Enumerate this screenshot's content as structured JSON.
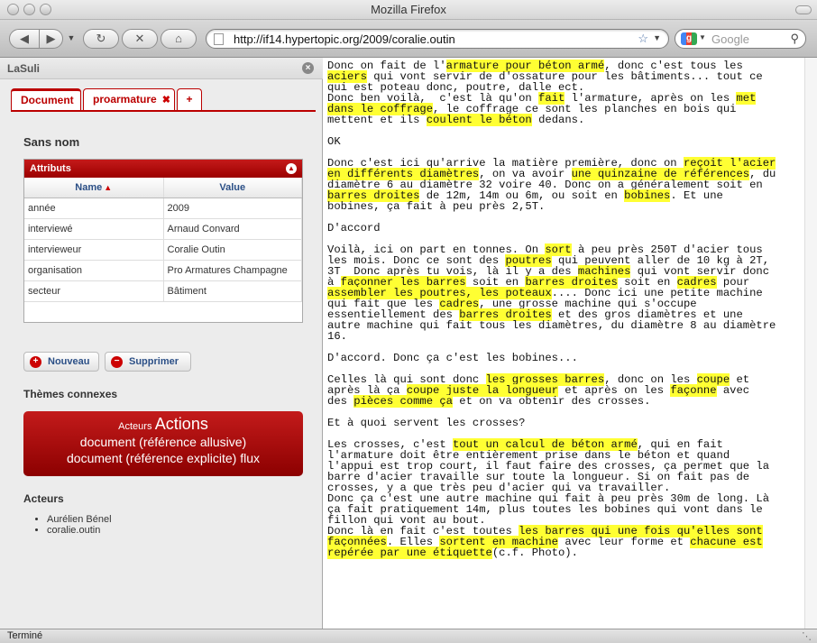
{
  "window": {
    "title": "Mozilla Firefox"
  },
  "toolbar": {
    "url": "http://if14.hypertopic.org/2009/coralie.outin",
    "search_placeholder": "Google",
    "search_engine_label": "g"
  },
  "sidebar": {
    "title": "LaSuli",
    "tabs": [
      {
        "label": "Document"
      },
      {
        "label": "proarmature"
      },
      {
        "label": "+"
      }
    ],
    "document_title": "Sans nom",
    "attributes": {
      "title": "Attributs",
      "col_name": "Name",
      "col_value": "Value",
      "rows": [
        {
          "name": "année",
          "value": "2009"
        },
        {
          "name": "interviewé",
          "value": "Arnaud Convard"
        },
        {
          "name": "intervieweur",
          "value": "Coralie Outin"
        },
        {
          "name": "organisation",
          "value": "Pro Armatures Champagne"
        },
        {
          "name": "secteur",
          "value": "Bâtiment"
        }
      ]
    },
    "buttons": {
      "new": "Nouveau",
      "delete": "Supprimer"
    },
    "themes_title": "Thèmes connexes",
    "tags": {
      "acteurs": "Acteurs",
      "actions": "Actions",
      "allusive": "document (référence allusive)",
      "explicite": "document (référence explicite)",
      "flux": "flux"
    },
    "acteurs_title": "Acteurs",
    "acteurs": [
      "Aurélien Bénel",
      "coralie.outin"
    ]
  },
  "content": {
    "paragraphs": [
      [
        {
          "t": "Donc on fait de l'"
        },
        {
          "h": "armature pour béton armé"
        },
        {
          "t": ", donc c'est tous les\n"
        },
        {
          "h": "aciers"
        },
        {
          "t": " qui vont servir de d'ossature pour les bâtiments... tout ce\nqui est poteau donc, poutre, dalle ect.\nDonc ben voilà,  c'est là qu'on "
        },
        {
          "h": "fait"
        },
        {
          "t": " l'armature, après on les "
        },
        {
          "h": "met\ndans le coffrage"
        },
        {
          "t": ", le coffrage ce sont les planches en bois qui\nmettent et ils "
        },
        {
          "h": "coulent le béton"
        },
        {
          "t": " dedans."
        }
      ],
      [
        {
          "t": "OK"
        }
      ],
      [
        {
          "t": "Donc c'est ici qu'arrive la matière première, donc on "
        },
        {
          "h": "reçoit l'acier\nen différents diamètres"
        },
        {
          "t": ", on va avoir "
        },
        {
          "h": "une quinzaine de références"
        },
        {
          "t": ", du\ndiamètre 6 au diamètre 32 voire 40. Donc on a généralement soit en\n"
        },
        {
          "h": "barres droites"
        },
        {
          "t": " de 12m, 14m ou 6m, ou soit en "
        },
        {
          "h": "bobines"
        },
        {
          "t": ". Et une\nbobines, ça fait à peu près 2,5T."
        }
      ],
      [
        {
          "t": "D'accord"
        }
      ],
      [
        {
          "t": "Voilà, ici on part en tonnes. On "
        },
        {
          "h": "sort"
        },
        {
          "t": " à peu près 250T d'acier tous\nles mois. Donc ce sont des "
        },
        {
          "h": "poutres"
        },
        {
          "t": " qui peuvent aller de 10 kg à 2T,\n3T  Donc après tu vois, là il y a des "
        },
        {
          "h": "machines"
        },
        {
          "t": " qui vont servir donc\nà "
        },
        {
          "h": "façonner les barres"
        },
        {
          "t": " soit en "
        },
        {
          "h": "barres droites"
        },
        {
          "t": " soit en "
        },
        {
          "h": "cadres"
        },
        {
          "t": " pour\n"
        },
        {
          "h": "assembler les poutres, les poteaux"
        },
        {
          "t": ".... Donc ici une petite machine\nqui fait que les "
        },
        {
          "h": "cadres"
        },
        {
          "t": ", une grosse machine qui s'occupe\nessentiellement des "
        },
        {
          "h": "barres droites"
        },
        {
          "t": " et des gros diamètres et une\nautre machine qui fait tous les diamètres, du diamètre 8 au diamètre\n16."
        }
      ],
      [
        {
          "t": "D'accord. Donc ça c'est les bobines..."
        }
      ],
      [
        {
          "t": "Celles là qui sont donc "
        },
        {
          "h": "les grosses barres"
        },
        {
          "t": ", donc on les "
        },
        {
          "h": "coupe"
        },
        {
          "t": " et\naprès là ça "
        },
        {
          "h": "coupe juste la longueur"
        },
        {
          "t": " et après on les "
        },
        {
          "h": "façonne"
        },
        {
          "t": " avec\ndes "
        },
        {
          "h": "pièces comme ça"
        },
        {
          "t": " et on va obtenir des crosses."
        }
      ],
      [
        {
          "t": "Et à quoi servent les crosses?"
        }
      ],
      [
        {
          "t": "Les crosses, c'est "
        },
        {
          "h": "tout un calcul de béton armé"
        },
        {
          "t": ", qui en fait\nl'armature doit être entièrement prise dans le béton et quand\nl'appui est trop court, il faut faire des crosses, ça permet que la\nbarre d'acier travaille sur toute la longueur. Si on fait pas de\ncrosses, y a que très peu d'acier qui va travailler.\nDonc ça c'est une autre machine qui fait à peu près 30m de long. Là\nça fait pratiquement 14m, plus toutes les bobines qui vont dans le\nfillon qui vont au bout.\nDonc là en fait c'est toutes "
        },
        {
          "h": "les barres qui une fois qu'elles sont\nfaçonnées"
        },
        {
          "t": ". Elles "
        },
        {
          "h": "sortent en machine"
        },
        {
          "t": " avec leur forme et "
        },
        {
          "h": "chacune est\nrepérée par une étiquette"
        },
        {
          "t": "(c.f. Photo)."
        }
      ]
    ]
  },
  "status": {
    "text": "Terminé"
  }
}
